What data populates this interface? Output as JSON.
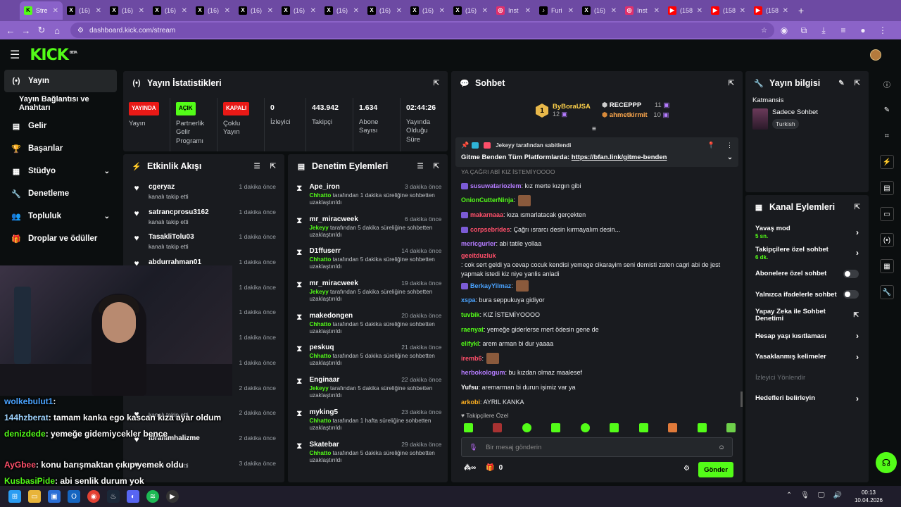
{
  "browser": {
    "tabs": [
      {
        "label": "Stre",
        "icon": "kick-icon",
        "active": true
      },
      {
        "label": "(16)",
        "icon": "x-icon"
      },
      {
        "label": "(16)",
        "icon": "x-icon"
      },
      {
        "label": "(16)",
        "icon": "x-icon"
      },
      {
        "label": "(16)",
        "icon": "x-icon"
      },
      {
        "label": "(16)",
        "icon": "x-icon"
      },
      {
        "label": "(16)",
        "icon": "x-icon"
      },
      {
        "label": "(16)",
        "icon": "x-icon"
      },
      {
        "label": "(16)",
        "icon": "x-icon"
      },
      {
        "label": "(16)",
        "icon": "x-icon"
      },
      {
        "label": "(16)",
        "icon": "x-icon"
      },
      {
        "label": "Inst",
        "icon": "instagram-icon"
      },
      {
        "label": "Furi",
        "icon": "tiktok-icon"
      },
      {
        "label": "(16)",
        "icon": "x-icon"
      },
      {
        "label": "Inst",
        "icon": "instagram-icon"
      },
      {
        "label": "(158",
        "icon": "youtube-icon"
      },
      {
        "label": "(158",
        "icon": "youtube-icon"
      },
      {
        "label": "(158",
        "icon": "youtube-icon"
      }
    ],
    "url": "dashboard.kick.com/stream"
  },
  "header": {
    "logo": "KICK",
    "logo_badge": "BETA"
  },
  "sidebar": {
    "items": [
      {
        "label": "Yayın",
        "icon": "broadcast-icon",
        "active": true
      },
      {
        "label": "Yayın Bağlantısı ve Anahtarı",
        "icon": ""
      },
      {
        "label": "Gelir",
        "icon": "revenue-icon"
      },
      {
        "label": "Başarılar",
        "icon": "trophy-icon"
      },
      {
        "label": "Stüdyo",
        "icon": "studio-icon",
        "chevron": true
      },
      {
        "label": "Denetleme",
        "icon": "wrench-icon"
      },
      {
        "label": "Topluluk",
        "icon": "community-icon",
        "chevron": true
      },
      {
        "label": "Droplar ve ödüller",
        "icon": "gift-icon"
      }
    ]
  },
  "stats": {
    "title": "Yayın İstatistikleri",
    "cols": [
      {
        "badge": "YAYINDA",
        "badge_color": "#e91916",
        "badge_text": "#fff",
        "label": "Yayın"
      },
      {
        "badge": "AÇIK",
        "badge_color": "#53fc18",
        "badge_text": "#000",
        "label": "Partnerlik Gelir Programı"
      },
      {
        "badge": "KAPALI",
        "badge_color": "#e91916",
        "badge_text": "#fff",
        "label": "Çoklu Yayın"
      },
      {
        "value": "0",
        "label": "İzleyici"
      },
      {
        "value": "443.942",
        "label": "Takipçi"
      },
      {
        "value": "1.634",
        "label": "Abone Sayısı"
      },
      {
        "value": "02:44:26",
        "label": "Yayında Olduğu Süre"
      }
    ]
  },
  "activity": {
    "title": "Etkinlik Akışı",
    "items": [
      {
        "name": "cgeryaz",
        "sub": "kanalı takip etti",
        "time": "1 dakika önce"
      },
      {
        "name": "satrancprosu3162",
        "sub": "kanalı takip etti",
        "time": "1 dakika önce"
      },
      {
        "name": "TasakliTolu03",
        "sub": "kanalı takip etti",
        "time": "1 dakika önce"
      },
      {
        "name": "abdurrahman01",
        "sub": "",
        "time": "1 dakika önce"
      },
      {
        "name": "",
        "sub": "",
        "time": "1 dakika önce"
      },
      {
        "name": "",
        "sub": "",
        "time": "1 dakika önce"
      },
      {
        "name": "",
        "sub": "",
        "time": "1 dakika önce"
      },
      {
        "name": "",
        "sub": "",
        "time": "1 dakika önce"
      },
      {
        "name": "",
        "sub": "kanalı takip etti",
        "time": "2 dakika önce"
      },
      {
        "name": "",
        "sub": "kanalı takip etti",
        "time": "2 dakika önce"
      },
      {
        "name": "ibrahimhalizme",
        "sub": "",
        "time": "2 dakika önce"
      },
      {
        "name": "",
        "sub": "kanalı takip etti",
        "time": "3 dakika önce"
      }
    ]
  },
  "moderation": {
    "title": "Denetim Eylemleri",
    "items": [
      {
        "name": "Ape_iron",
        "mod": "Chhatto",
        "desc": "tarafından 1 dakika süreliğine sohbetten uzaklaştırıldı",
        "time": "3 dakika önce"
      },
      {
        "name": "mr_miracweek",
        "mod": "Jekeyy",
        "desc": "tarafından 5 dakika süreliğine sohbetten uzaklaştırıldı",
        "time": "6 dakika önce"
      },
      {
        "name": "D1ffuserr",
        "mod": "Chhatto",
        "desc": "tarafından 5 dakika süreliğine sohbetten uzaklaştırıldı",
        "time": "14 dakika önce"
      },
      {
        "name": "mr_miracweek",
        "mod": "Jekeyy",
        "desc": "tarafından 5 dakika süreliğine sohbetten uzaklaştırıldı",
        "time": "19 dakika önce"
      },
      {
        "name": "makedongen",
        "mod": "Chhatto",
        "desc": "tarafından 5 dakika süreliğine sohbetten uzaklaştırıldı",
        "time": "20 dakika önce"
      },
      {
        "name": "peskuq",
        "mod": "Chhatto",
        "desc": "tarafından 5 dakika süreliğine sohbetten uzaklaştırıldı",
        "time": "21 dakika önce"
      },
      {
        "name": "Enginaar",
        "mod": "Jekeyy",
        "desc": "tarafından 5 dakika süreliğine sohbetten uzaklaştırıldı",
        "time": "22 dakika önce"
      },
      {
        "name": "myking5",
        "mod": "Chhatto",
        "desc": "tarafından 1 hafta süreliğine sohbetten uzaklaştırıldı",
        "time": "23 dakika önce"
      },
      {
        "name": "Skatebar",
        "mod": "Chhatto",
        "desc": "tarafından 5 dakika süreliğine sohbetten uzaklaştırıldı",
        "time": "29 dakika önce"
      }
    ]
  },
  "chat": {
    "title": "Sohbet",
    "leader": {
      "rank": "1",
      "name": "ByBoraUSA",
      "count": "12"
    },
    "leader2": {
      "name": "RECEPPP",
      "count": "11"
    },
    "leader3": {
      "name": "ahmetkirmit",
      "count": "10"
    },
    "pinned_by": "Jekeyy tarafından sabitlendi",
    "pinned_text": "Gitme Benden Tüm Platformlarda:",
    "pinned_link": "https://bfan.link/gitme-benden",
    "partial_line": "YA ÇAĞRI ABİ KIZ İSTEMİYOOOO",
    "messages": [
      {
        "user": "susuwatariozlem",
        "color": "#b57cff",
        "text": ": kız merte kızgın gibi",
        "badge": true
      },
      {
        "user": "OnionCutterNinja",
        "color": "#53fc18",
        "text": ":",
        "emote": true
      },
      {
        "user": "makarnaaa",
        "color": "#ff4f6a",
        "text": ": kıza ısmarlatacak gerçekten",
        "badge": true
      },
      {
        "user": "corpsebrides",
        "color": "#ff4f6a",
        "text": ": Çağrı ısrarcı desin kırmayalım desin...",
        "badge": true
      },
      {
        "user": "mericgurler",
        "color": "#b57cff",
        "text": ": abi tatile yollaa"
      },
      {
        "user": "geeitduzluk",
        "color": "#ff4f6a",
        "text": ": cok sert geldi ya cevap cocuk kendisi yemege cikarayim seni demisti zaten cagri abi de jest yapmak istedi kiz niye yanlis anladi"
      },
      {
        "user": "BerkayYilmaz",
        "color": "#4aa3ff",
        "text": ":",
        "emote": true,
        "badge": true
      },
      {
        "user": "xspa",
        "color": "#4aa3ff",
        "text": ": bura seppukuya gidiyor"
      },
      {
        "user": "tuvbik",
        "color": "#53fc18",
        "text": ": KIZ İSTEMİYOOOO"
      },
      {
        "user": "raenyat",
        "color": "#53fc18",
        "text": ": yemeğe giderlerse mert ödesin gene de"
      },
      {
        "user": "elifykl",
        "color": "#53fc18",
        "text": ": arem arman bi dur yaaaa"
      },
      {
        "user": "iremb6",
        "color": "#ff4f6a",
        "text": ":",
        "emote": true
      },
      {
        "user": "herbokologum",
        "color": "#b57cff",
        "text": ": bu kızdan olmaz maalesef"
      },
      {
        "user": "Yufsu",
        "color": "#fff",
        "text": ": aremarman bi durun işimiz var ya"
      },
      {
        "user": "arkobi",
        "color": "#ffb020",
        "text": ": AYRIL KANKA"
      }
    ],
    "follower_only": "Takipçilere Özel",
    "input_placeholder": "Bir mesaj gönderin",
    "points": "0",
    "send": "Gönder"
  },
  "streaminfo": {
    "title": "Yayın bilgisi",
    "category": "Katmansis",
    "mode": "Sadece Sohbet",
    "lang": "Turkish"
  },
  "channel_actions": {
    "title": "Kanal Eylemleri",
    "items": [
      {
        "label": "Yavaş mod",
        "sub": "5 sn.",
        "type": "chevron"
      },
      {
        "label": "Takipçilere özel sohbet",
        "sub": "6 dk.",
        "type": "chevron"
      },
      {
        "label": "Abonelere özel sohbet",
        "type": "toggle"
      },
      {
        "label": "Yalnızca ifadelerle sohbet",
        "type": "toggle"
      },
      {
        "label": "Yapay Zeka ile Sohbet Denetimi",
        "type": "external"
      },
      {
        "label": "Hesap yaşı kısıtlaması",
        "type": "chevron"
      },
      {
        "label": "Yasaklanmış kelimeler",
        "type": "chevron"
      },
      {
        "label": "İzleyici Yönlendir",
        "type": "disabled"
      },
      {
        "label": "Hedefleri belirleyin",
        "type": "chevron"
      }
    ]
  },
  "overlay_chat": [
    {
      "user": "wolkebulut1",
      "color": "#4aa3ff",
      "text": ":"
    },
    {
      "user": "144hzberat",
      "color": "#9fd4ff",
      "text": ": tamam kanka ego kascan kıza ayar oldum"
    },
    {
      "user": "denizdede",
      "color": "#53fc18",
      "text": ": yemeğe gidemiycekler bence"
    },
    {
      "user": "AyGbee",
      "color": "#ff4f6a",
      "text": ": konu barışmaktan çıkıp yemek oldu"
    },
    {
      "user": "KusbasiPide",
      "color": "#53fc18",
      "text": ": abi senlik durum yok"
    }
  ],
  "taskbar": {
    "time": "00:13",
    "date": "10.04.2026"
  }
}
